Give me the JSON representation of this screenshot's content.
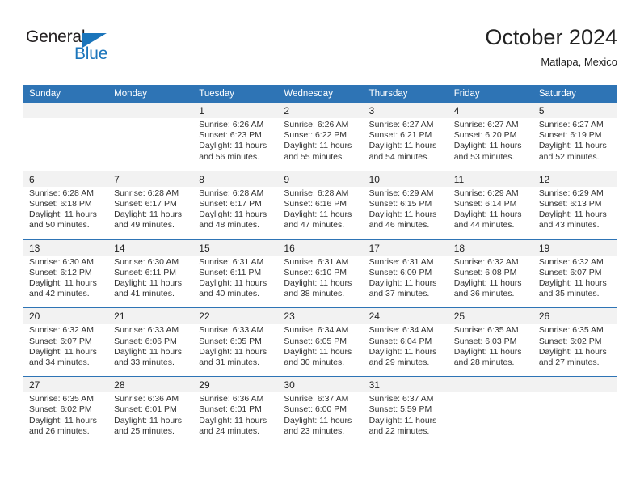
{
  "brand": {
    "name_top": "General",
    "name_bottom": "Blue",
    "accent_color": "#1b75bb",
    "text_color": "#231f20"
  },
  "header": {
    "title": "October 2024",
    "subtitle": "Matlapa, Mexico"
  },
  "theme": {
    "header_bg": "#2e74b5",
    "header_text": "#ffffff",
    "daynum_bg": "#f2f2f2",
    "cell_bg": "#ffffff",
    "separator": "#2e74b5"
  },
  "weekdays": [
    "Sunday",
    "Monday",
    "Tuesday",
    "Wednesday",
    "Thursday",
    "Friday",
    "Saturday"
  ],
  "weeks": [
    {
      "days": [
        {
          "number": "",
          "sunrise": "",
          "sunset": "",
          "daylight_line1": "",
          "daylight_line2": ""
        },
        {
          "number": "",
          "sunrise": "",
          "sunset": "",
          "daylight_line1": "",
          "daylight_line2": ""
        },
        {
          "number": "1",
          "sunrise": "Sunrise: 6:26 AM",
          "sunset": "Sunset: 6:23 PM",
          "daylight_line1": "Daylight: 11 hours",
          "daylight_line2": "and 56 minutes."
        },
        {
          "number": "2",
          "sunrise": "Sunrise: 6:26 AM",
          "sunset": "Sunset: 6:22 PM",
          "daylight_line1": "Daylight: 11 hours",
          "daylight_line2": "and 55 minutes."
        },
        {
          "number": "3",
          "sunrise": "Sunrise: 6:27 AM",
          "sunset": "Sunset: 6:21 PM",
          "daylight_line1": "Daylight: 11 hours",
          "daylight_line2": "and 54 minutes."
        },
        {
          "number": "4",
          "sunrise": "Sunrise: 6:27 AM",
          "sunset": "Sunset: 6:20 PM",
          "daylight_line1": "Daylight: 11 hours",
          "daylight_line2": "and 53 minutes."
        },
        {
          "number": "5",
          "sunrise": "Sunrise: 6:27 AM",
          "sunset": "Sunset: 6:19 PM",
          "daylight_line1": "Daylight: 11 hours",
          "daylight_line2": "and 52 minutes."
        }
      ]
    },
    {
      "days": [
        {
          "number": "6",
          "sunrise": "Sunrise: 6:28 AM",
          "sunset": "Sunset: 6:18 PM",
          "daylight_line1": "Daylight: 11 hours",
          "daylight_line2": "and 50 minutes."
        },
        {
          "number": "7",
          "sunrise": "Sunrise: 6:28 AM",
          "sunset": "Sunset: 6:17 PM",
          "daylight_line1": "Daylight: 11 hours",
          "daylight_line2": "and 49 minutes."
        },
        {
          "number": "8",
          "sunrise": "Sunrise: 6:28 AM",
          "sunset": "Sunset: 6:17 PM",
          "daylight_line1": "Daylight: 11 hours",
          "daylight_line2": "and 48 minutes."
        },
        {
          "number": "9",
          "sunrise": "Sunrise: 6:28 AM",
          "sunset": "Sunset: 6:16 PM",
          "daylight_line1": "Daylight: 11 hours",
          "daylight_line2": "and 47 minutes."
        },
        {
          "number": "10",
          "sunrise": "Sunrise: 6:29 AM",
          "sunset": "Sunset: 6:15 PM",
          "daylight_line1": "Daylight: 11 hours",
          "daylight_line2": "and 46 minutes."
        },
        {
          "number": "11",
          "sunrise": "Sunrise: 6:29 AM",
          "sunset": "Sunset: 6:14 PM",
          "daylight_line1": "Daylight: 11 hours",
          "daylight_line2": "and 44 minutes."
        },
        {
          "number": "12",
          "sunrise": "Sunrise: 6:29 AM",
          "sunset": "Sunset: 6:13 PM",
          "daylight_line1": "Daylight: 11 hours",
          "daylight_line2": "and 43 minutes."
        }
      ]
    },
    {
      "days": [
        {
          "number": "13",
          "sunrise": "Sunrise: 6:30 AM",
          "sunset": "Sunset: 6:12 PM",
          "daylight_line1": "Daylight: 11 hours",
          "daylight_line2": "and 42 minutes."
        },
        {
          "number": "14",
          "sunrise": "Sunrise: 6:30 AM",
          "sunset": "Sunset: 6:11 PM",
          "daylight_line1": "Daylight: 11 hours",
          "daylight_line2": "and 41 minutes."
        },
        {
          "number": "15",
          "sunrise": "Sunrise: 6:31 AM",
          "sunset": "Sunset: 6:11 PM",
          "daylight_line1": "Daylight: 11 hours",
          "daylight_line2": "and 40 minutes."
        },
        {
          "number": "16",
          "sunrise": "Sunrise: 6:31 AM",
          "sunset": "Sunset: 6:10 PM",
          "daylight_line1": "Daylight: 11 hours",
          "daylight_line2": "and 38 minutes."
        },
        {
          "number": "17",
          "sunrise": "Sunrise: 6:31 AM",
          "sunset": "Sunset: 6:09 PM",
          "daylight_line1": "Daylight: 11 hours",
          "daylight_line2": "and 37 minutes."
        },
        {
          "number": "18",
          "sunrise": "Sunrise: 6:32 AM",
          "sunset": "Sunset: 6:08 PM",
          "daylight_line1": "Daylight: 11 hours",
          "daylight_line2": "and 36 minutes."
        },
        {
          "number": "19",
          "sunrise": "Sunrise: 6:32 AM",
          "sunset": "Sunset: 6:07 PM",
          "daylight_line1": "Daylight: 11 hours",
          "daylight_line2": "and 35 minutes."
        }
      ]
    },
    {
      "days": [
        {
          "number": "20",
          "sunrise": "Sunrise: 6:32 AM",
          "sunset": "Sunset: 6:07 PM",
          "daylight_line1": "Daylight: 11 hours",
          "daylight_line2": "and 34 minutes."
        },
        {
          "number": "21",
          "sunrise": "Sunrise: 6:33 AM",
          "sunset": "Sunset: 6:06 PM",
          "daylight_line1": "Daylight: 11 hours",
          "daylight_line2": "and 33 minutes."
        },
        {
          "number": "22",
          "sunrise": "Sunrise: 6:33 AM",
          "sunset": "Sunset: 6:05 PM",
          "daylight_line1": "Daylight: 11 hours",
          "daylight_line2": "and 31 minutes."
        },
        {
          "number": "23",
          "sunrise": "Sunrise: 6:34 AM",
          "sunset": "Sunset: 6:05 PM",
          "daylight_line1": "Daylight: 11 hours",
          "daylight_line2": "and 30 minutes."
        },
        {
          "number": "24",
          "sunrise": "Sunrise: 6:34 AM",
          "sunset": "Sunset: 6:04 PM",
          "daylight_line1": "Daylight: 11 hours",
          "daylight_line2": "and 29 minutes."
        },
        {
          "number": "25",
          "sunrise": "Sunrise: 6:35 AM",
          "sunset": "Sunset: 6:03 PM",
          "daylight_line1": "Daylight: 11 hours",
          "daylight_line2": "and 28 minutes."
        },
        {
          "number": "26",
          "sunrise": "Sunrise: 6:35 AM",
          "sunset": "Sunset: 6:02 PM",
          "daylight_line1": "Daylight: 11 hours",
          "daylight_line2": "and 27 minutes."
        }
      ]
    },
    {
      "days": [
        {
          "number": "27",
          "sunrise": "Sunrise: 6:35 AM",
          "sunset": "Sunset: 6:02 PM",
          "daylight_line1": "Daylight: 11 hours",
          "daylight_line2": "and 26 minutes."
        },
        {
          "number": "28",
          "sunrise": "Sunrise: 6:36 AM",
          "sunset": "Sunset: 6:01 PM",
          "daylight_line1": "Daylight: 11 hours",
          "daylight_line2": "and 25 minutes."
        },
        {
          "number": "29",
          "sunrise": "Sunrise: 6:36 AM",
          "sunset": "Sunset: 6:01 PM",
          "daylight_line1": "Daylight: 11 hours",
          "daylight_line2": "and 24 minutes."
        },
        {
          "number": "30",
          "sunrise": "Sunrise: 6:37 AM",
          "sunset": "Sunset: 6:00 PM",
          "daylight_line1": "Daylight: 11 hours",
          "daylight_line2": "and 23 minutes."
        },
        {
          "number": "31",
          "sunrise": "Sunrise: 6:37 AM",
          "sunset": "Sunset: 5:59 PM",
          "daylight_line1": "Daylight: 11 hours",
          "daylight_line2": "and 22 minutes."
        },
        {
          "number": "",
          "sunrise": "",
          "sunset": "",
          "daylight_line1": "",
          "daylight_line2": ""
        },
        {
          "number": "",
          "sunrise": "",
          "sunset": "",
          "daylight_line1": "",
          "daylight_line2": ""
        }
      ]
    }
  ]
}
